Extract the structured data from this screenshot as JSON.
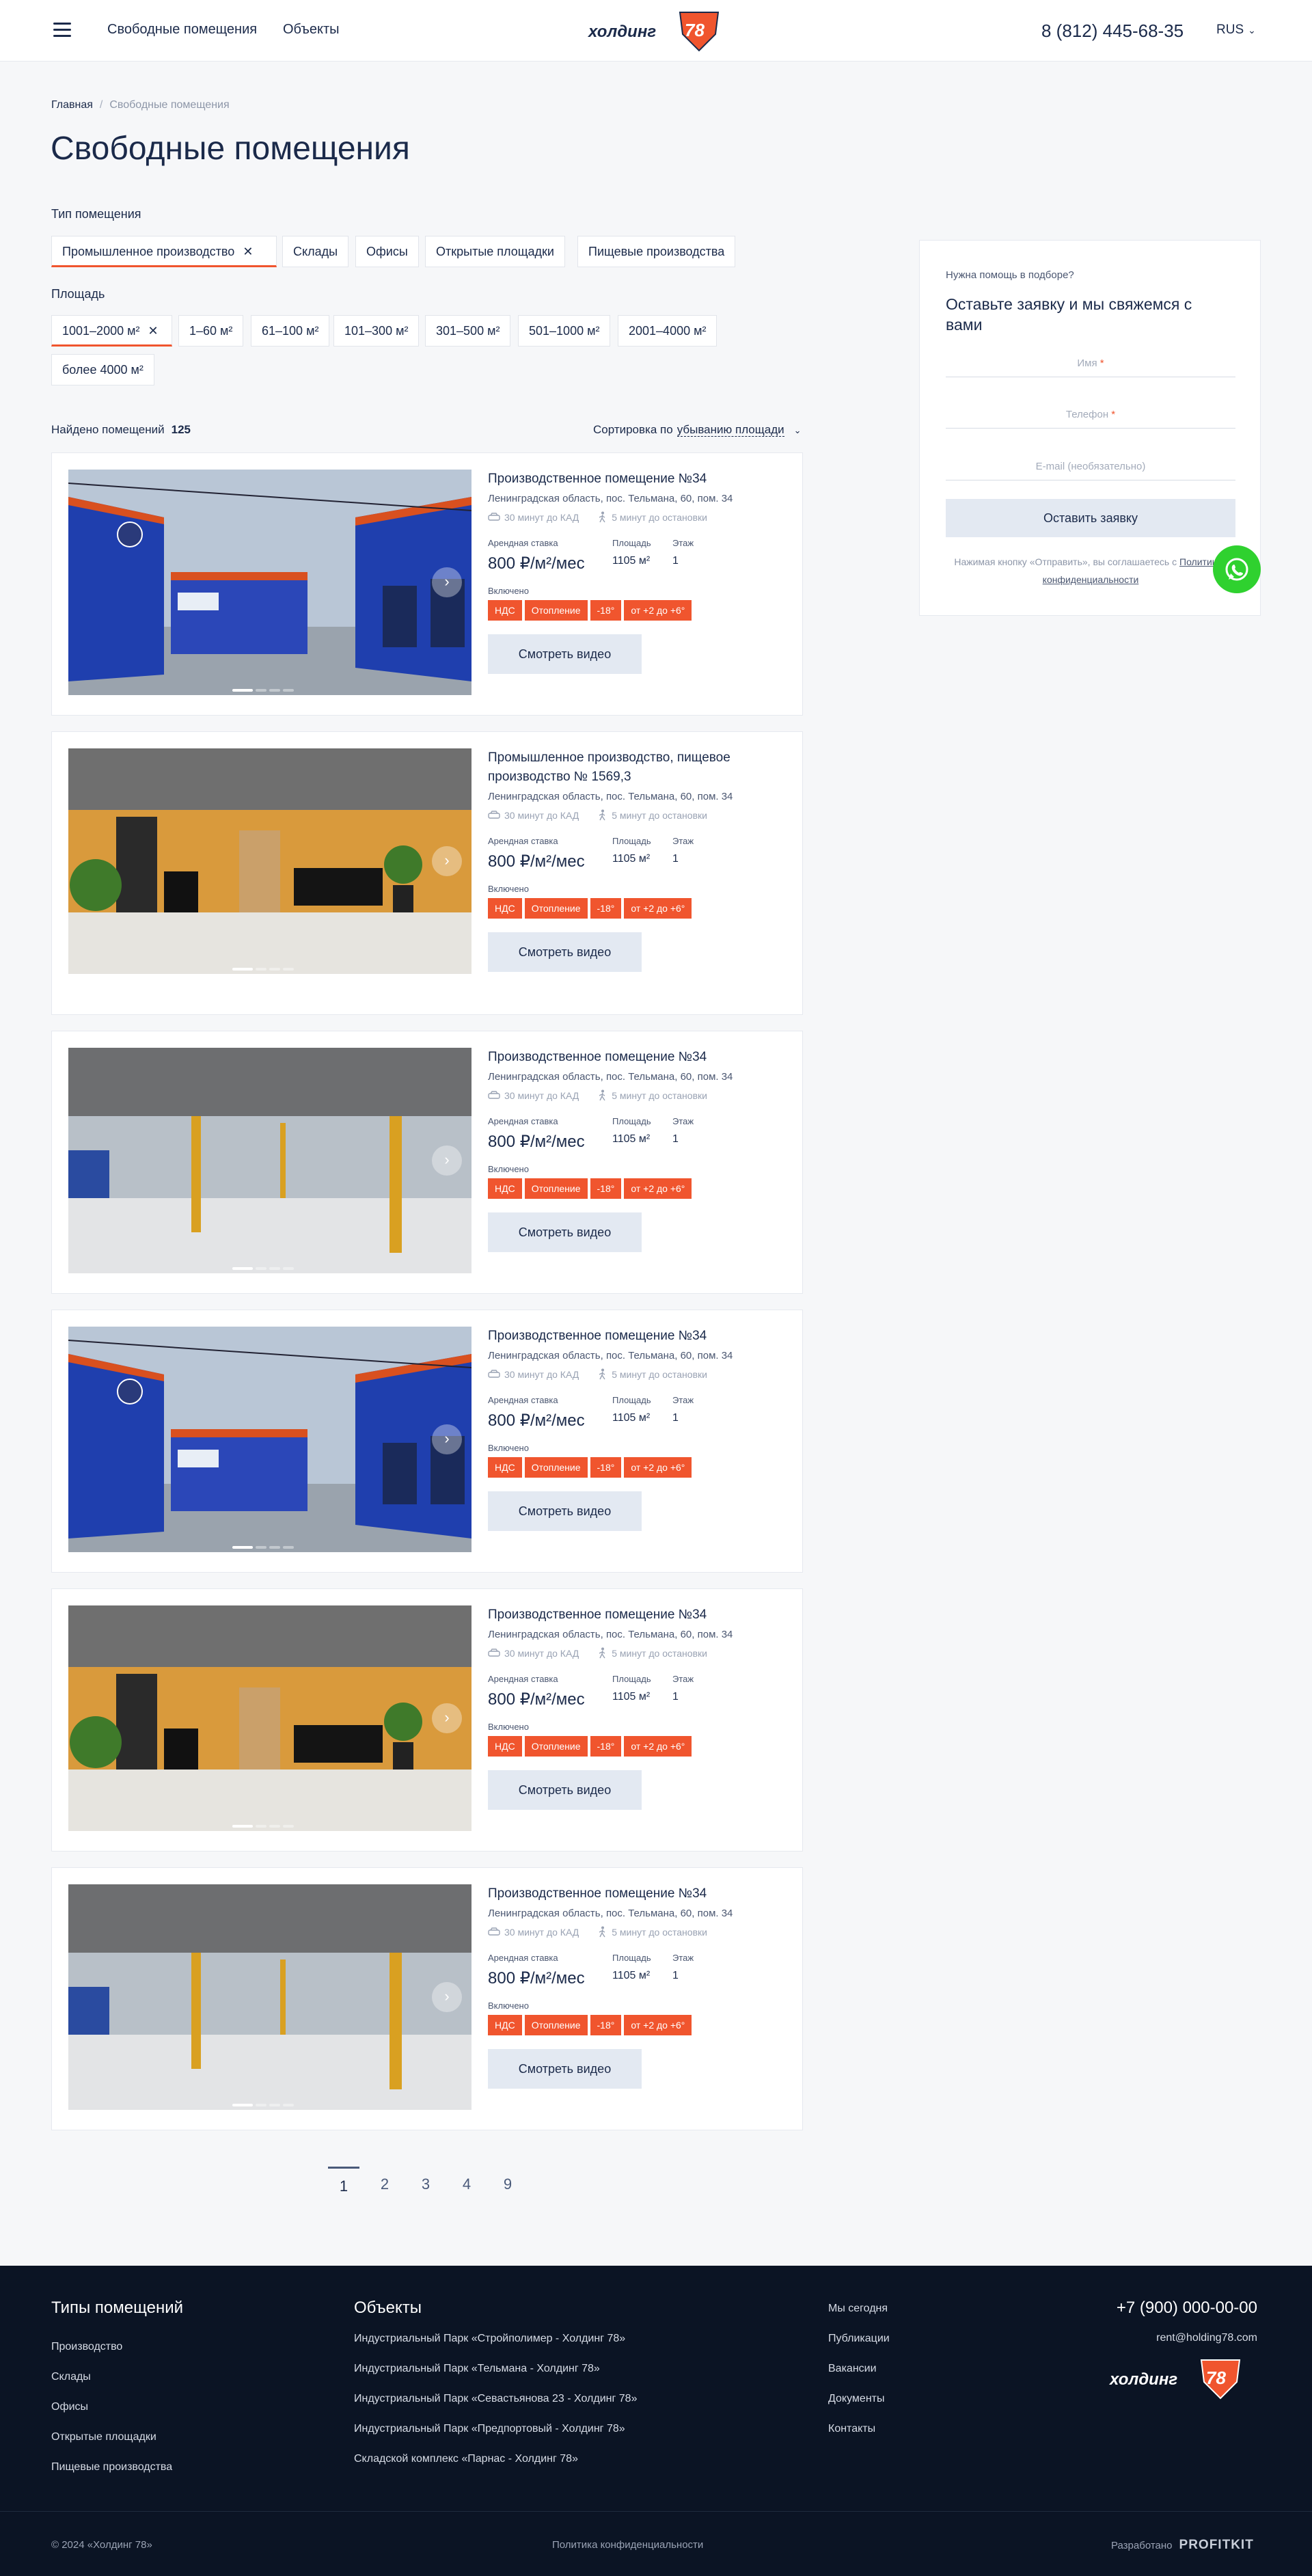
{
  "colors": {
    "accent": "#f0552e",
    "navy": "#1b2a4a",
    "footer_bg": "#0b1424",
    "whatsapp": "#2fd12f"
  },
  "header": {
    "menu_icon": "burger-icon",
    "nav": [
      "Свободные помещения",
      "Объекты"
    ],
    "logo_text": "холдинг",
    "logo_number": "78",
    "phone": "8 (812) 445-68-35",
    "lang": "RUS"
  },
  "breadcrumb": {
    "home": "Главная",
    "sep": "/",
    "current": "Свободные помещения"
  },
  "page_title": "Свободные помещения",
  "filters": {
    "type_label": "Тип помещения",
    "types": [
      "Промышленное производство",
      "Склады",
      "Офисы",
      "Открытые площадки",
      "Пищевые производства"
    ],
    "area_label": "Площадь",
    "areas": [
      "1001–2000 м²",
      "1–60 м²",
      "61–100 м²",
      "101–300 м²",
      "301–500 м²",
      "501–1000 м²",
      "2001–4000 м²",
      "более 4000 м²"
    ]
  },
  "results": {
    "found_label": "Найдено помещений",
    "found_count": "125",
    "sort_label": "Сортировка по",
    "sort_value": "убыванию площади"
  },
  "card_labels": {
    "rate": "Арендная ставка",
    "area": "Площадь",
    "floor": "Этаж",
    "included": "Включено",
    "video": "Смотреть видео",
    "kad": "30 минут до КАД",
    "stop": "5 минут до остановки"
  },
  "listings": [
    {
      "title": "Производственное помещение №34",
      "address": "Ленинградская область, пос. Тельмана, 60, пом. 34",
      "rate": "800 ₽/м²/мес",
      "area": "1105 м²",
      "floor": "1",
      "tags": [
        "НДС",
        "Отопление",
        "-18°",
        "от +2 до +6°"
      ]
    },
    {
      "title": "Промышленное производство, пищевое производство № 1569,3",
      "address": "Ленинградская область, пос. Тельмана, 60, пом. 34",
      "rate": "800 ₽/м²/мес",
      "area": "1105 м²",
      "floor": "1",
      "tags": [
        "НДС",
        "Отопление",
        "-18°",
        "от +2 до +6°"
      ]
    },
    {
      "title": "Производственное помещение №34",
      "address": "Ленинградская область, пос. Тельмана, 60, пом. 34",
      "rate": "800 ₽/м²/мес",
      "area": "1105 м²",
      "floor": "1",
      "tags": [
        "НДС",
        "Отопление",
        "-18°",
        "от +2 до +6°"
      ]
    },
    {
      "title": "Производственное помещение №34",
      "address": "Ленинградская область, пос. Тельмана, 60, пом. 34",
      "rate": "800 ₽/м²/мес",
      "area": "1105 м²",
      "floor": "1",
      "tags": [
        "НДС",
        "Отопление",
        "-18°",
        "от +2 до +6°"
      ]
    },
    {
      "title": "Производственное помещение №34",
      "address": "Ленинградская область, пос. Тельмана, 60, пом. 34",
      "rate": "800 ₽/м²/мес",
      "area": "1105 м²",
      "floor": "1",
      "tags": [
        "НДС",
        "Отопление",
        "-18°",
        "от +2 до +6°"
      ]
    },
    {
      "title": "Производственное помещение №34",
      "address": "Ленинградская область, пос. Тельмана, 60, пом. 34",
      "rate": "800 ₽/м²/мес",
      "area": "1105 м²",
      "floor": "1",
      "tags": [
        "НДС",
        "Отопление",
        "-18°",
        "от +2 до +6°"
      ]
    }
  ],
  "form": {
    "kicker": "Нужна помощь в подборе?",
    "title": "Оставьте заявку и мы свяжемся с вами",
    "name_placeholder": "Имя",
    "phone_placeholder": "Телефон",
    "email_placeholder": "E-mail (необязательно)",
    "required_mark": "*",
    "submit": "Оставить заявку",
    "consent": "Нажимая кнопку «Отправить», вы соглашаетесь с",
    "policy_link": "Политикой конфиденциальности"
  },
  "pagination": {
    "pages": [
      "1",
      "2",
      "3",
      "4",
      "9"
    ],
    "current": "1"
  },
  "footer": {
    "types_title": "Типы помещений",
    "types": [
      "Производство",
      "Склады",
      "Офисы",
      "Открытые площадки",
      "Пищевые производства"
    ],
    "objects_title": "Объекты",
    "objects": [
      "Индустриальный Парк «Стройполимер - Холдинг 78»",
      "Индустриальный Парк «Тельмана - Холдинг 78»",
      "Индустриальный Парк «Севастьянова 23 - Холдинг 78»",
      "Индустриальный Парк «Предпортовый - Холдинг 78»",
      "Складской комплекс «Парнас - Холдинг 78»"
    ],
    "company": [
      "Мы сегодня",
      "Публикации",
      "Вакансии",
      "Документы",
      "Контакты"
    ],
    "phone": "+7 (900) 000-00-00",
    "email": "rent@holding78.com",
    "copyright": "© 2024 «Холдинг 78»",
    "policy": "Политика конфиденциальности",
    "developed_label": "Разработано",
    "developer": "PROFITKIT"
  }
}
